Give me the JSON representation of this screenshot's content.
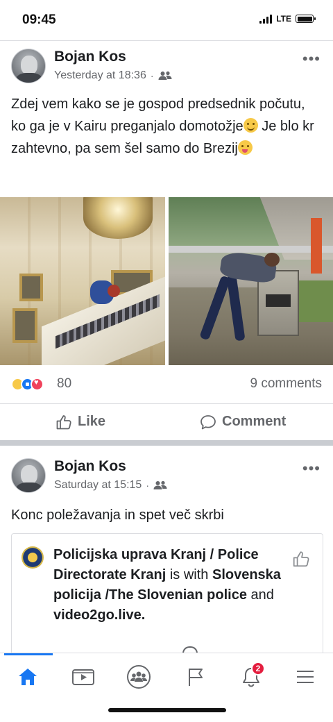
{
  "status_bar": {
    "time": "09:45",
    "network": "LTE"
  },
  "posts": [
    {
      "author": "Bojan Kos",
      "timestamp": "Yesterday at 18:36",
      "text_parts": [
        "Zdej vem kako se je gospod predsednik počutu, ko ga je v Kairu preganjalo domotožje",
        " Je blo kr zahtevno, pa sem šel samo do Brezij"
      ],
      "reaction_count": "80",
      "comments": "9 comments",
      "like_label": "Like",
      "comment_label": "Comment"
    },
    {
      "author": "Bojan Kos",
      "timestamp": "Saturday at 15:15",
      "text": "Konc poležavanja in spet več skrbi",
      "shared": {
        "page_name": "Policijska uprava Kranj / Police Directorate Kranj",
        "with_word": "is with",
        "tagged_1": "Slovenska policija /The Slovenian police",
        "and_word": "and",
        "tagged_2": "video2go.live."
      }
    }
  ],
  "icons": {
    "friends": "friends-icon",
    "more": "more-options-icon",
    "like": "thumbs-up-icon",
    "comment": "comment-bubble-icon",
    "nav": [
      "home-icon",
      "video-icon",
      "groups-icon",
      "flag-icon",
      "bell-icon",
      "menu-icon"
    ]
  },
  "nav": {
    "notifications_badge": "2"
  },
  "colors": {
    "accent": "#1877f2",
    "badge": "#e41e3f",
    "muted": "#65676b"
  }
}
